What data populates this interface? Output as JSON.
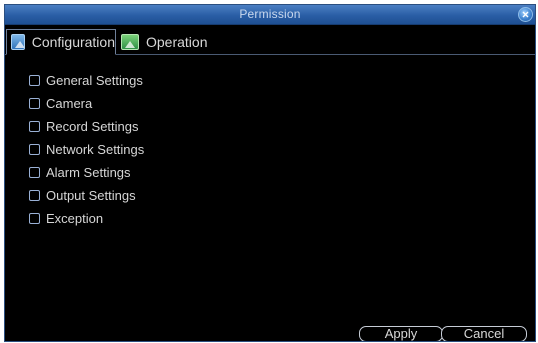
{
  "window": {
    "title": "Permission",
    "close_icon": "close-icon"
  },
  "tabs": [
    {
      "label": "Configuration",
      "icon": "configuration-tab-icon",
      "active": true
    },
    {
      "label": "Operation",
      "icon": "operation-tab-icon",
      "active": false
    }
  ],
  "permissions": [
    {
      "label": "General Settings",
      "checked": false
    },
    {
      "label": "Camera",
      "checked": false
    },
    {
      "label": "Record Settings",
      "checked": false
    },
    {
      "label": "Network Settings",
      "checked": false
    },
    {
      "label": "Alarm Settings",
      "checked": false
    },
    {
      "label": "Output Settings",
      "checked": false
    },
    {
      "label": "Exception",
      "checked": false
    }
  ],
  "buttons": {
    "apply": "Apply",
    "cancel": "Cancel"
  },
  "colors": {
    "titlebar": "#2a5ea5",
    "background": "#000000",
    "text": "#d6d6d6",
    "checkbox_border": "#9ab1d6"
  }
}
